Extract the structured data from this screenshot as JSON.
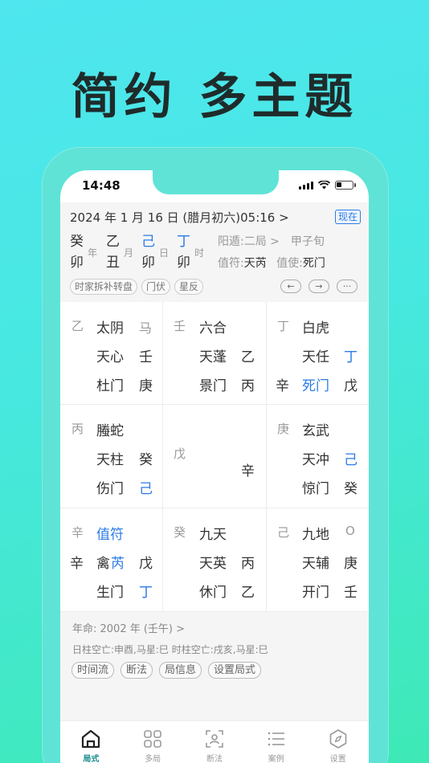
{
  "headline": "简约 多主题",
  "status": {
    "time": "14:48"
  },
  "header": {
    "date_line": "2024 年 1 月 16 日 (腊月初六)05:16 >",
    "now_badge": "现在"
  },
  "pillars": [
    {
      "stem": "癸",
      "branch": "卯",
      "unit": "年",
      "stem_blue": false
    },
    {
      "stem": "乙",
      "branch": "丑",
      "unit": "月",
      "stem_blue": false
    },
    {
      "stem": "己",
      "branch": "卯",
      "unit": "日",
      "stem_blue": true
    },
    {
      "stem": "丁",
      "branch": "卯",
      "unit": "时",
      "stem_blue": true
    }
  ],
  "ju_info": {
    "dun": "阳遁:二局 >",
    "xun": "甲子旬",
    "zhifu_label": "值符:",
    "zhifu_value": "天芮",
    "zhishi_label": "值使:",
    "zhishi_value": "死门"
  },
  "chips": [
    "时家拆补转盘",
    "门伏",
    "星反"
  ],
  "nav_buttons": [
    "←",
    "→",
    "···"
  ],
  "palaces": [
    {
      "g": "乙",
      "god": "太阴",
      "r1": "马",
      "star": "天心",
      "r2": "壬",
      "door": "杜门",
      "r3": "庚"
    },
    {
      "g": "壬",
      "god": "六合",
      "r1": "",
      "star": "天蓬",
      "r2": "乙",
      "door": "景门",
      "r3": "丙"
    },
    {
      "g": "丁",
      "god": "白虎",
      "r1": "",
      "star": "天任",
      "r2": "丁",
      "door": "死门",
      "r3": "戊",
      "door_prefix": "辛"
    },
    {
      "g": "丙",
      "god": "螣蛇",
      "r1": "",
      "star": "天柱",
      "r2": "癸",
      "door": "伤门",
      "r3": "己"
    },
    {
      "g": "戊",
      "center_right": "辛"
    },
    {
      "g": "庚",
      "god": "玄武",
      "r1": "",
      "star": "天冲",
      "r2": "己",
      "door": "惊门",
      "r3": "癸"
    },
    {
      "g": "辛",
      "god": "值符",
      "r1": "",
      "star_prefix": "辛",
      "star_a": "禽",
      "star_b": "芮",
      "r2": "戊",
      "door": "生门",
      "r3": "丁"
    },
    {
      "g": "癸",
      "god": "九天",
      "r1": "",
      "star": "天英",
      "r2": "丙",
      "door": "休门",
      "r3": "乙"
    },
    {
      "g": "己",
      "god": "九地",
      "r1": "O",
      "star": "天辅",
      "r2": "庚",
      "door": "开门",
      "r3": "壬"
    }
  ],
  "bottom": {
    "nianming": "年命:  2002 年 (壬午) >",
    "kongwang": "日柱空亡:申酉,马星:巳 时柱空亡:戌亥,马星:巳",
    "chips": [
      "时间流",
      "断法",
      "局信息",
      "设置局式"
    ]
  },
  "tabs": [
    {
      "label": "局式",
      "icon": "home-icon",
      "active": true
    },
    {
      "label": "多局",
      "icon": "grid-icon",
      "active": false
    },
    {
      "label": "断法",
      "icon": "scan-icon",
      "active": false
    },
    {
      "label": "案例",
      "icon": "list-icon",
      "active": false
    },
    {
      "label": "设置",
      "icon": "compass-icon",
      "active": false
    }
  ],
  "colors": {
    "accent_blue": "#2c7be5",
    "tab_active": "#1b8c8c",
    "bg_teal": "#4fe6ef"
  }
}
